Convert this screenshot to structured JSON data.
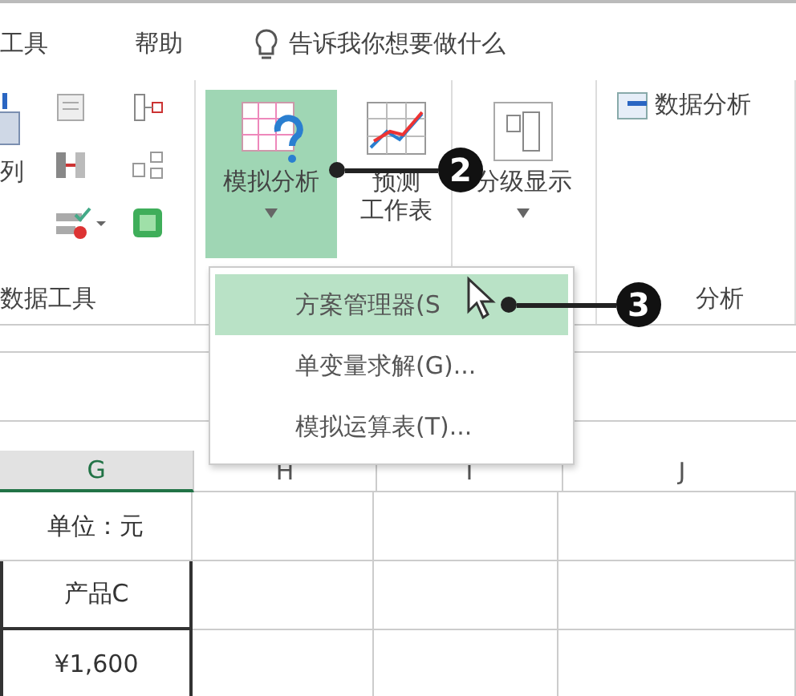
{
  "menu_tabs": [
    {
      "label": "工具",
      "selected": false
    },
    {
      "label": "帮助",
      "selected": false
    }
  ],
  "tell_me": {
    "placeholder": "告诉我你想要做什么"
  },
  "ribbon": {
    "groups": [
      {
        "kind": "tools",
        "label": "数据工具",
        "commands": [
          {
            "label": "列"
          }
        ]
      },
      {
        "kind": "forecast",
        "commands": [
          {
            "label": "模拟分析",
            "selected": true,
            "expanded": true
          },
          {
            "lines": [
              "预测",
              "工作表"
            ],
            "selected": false
          }
        ]
      },
      {
        "kind": "outline",
        "commands": [
          {
            "label": "分级显示"
          }
        ]
      },
      {
        "kind": "analysis",
        "label": "分析",
        "commands": [
          {
            "label": "数据分析"
          }
        ]
      }
    ]
  },
  "dropdown": {
    "items": [
      {
        "label": "方案管理器(S",
        "selected": true
      },
      {
        "label": "单变量求解(G)...",
        "selected": false
      },
      {
        "label": "模拟运算表(T)...",
        "selected": false
      }
    ]
  },
  "callouts": [
    "2",
    "3"
  ],
  "sheet": {
    "columns": [
      {
        "label": "G",
        "selected": true
      },
      {
        "label": "H",
        "selected": false
      },
      {
        "label": "I",
        "selected": false
      },
      {
        "label": "J",
        "selected": false
      }
    ],
    "rows": [
      {
        "value": "单位：元",
        "bordered": false
      },
      {
        "value": "产品C",
        "bordered": true
      },
      {
        "value": "¥1,600",
        "bordered": true
      }
    ]
  }
}
